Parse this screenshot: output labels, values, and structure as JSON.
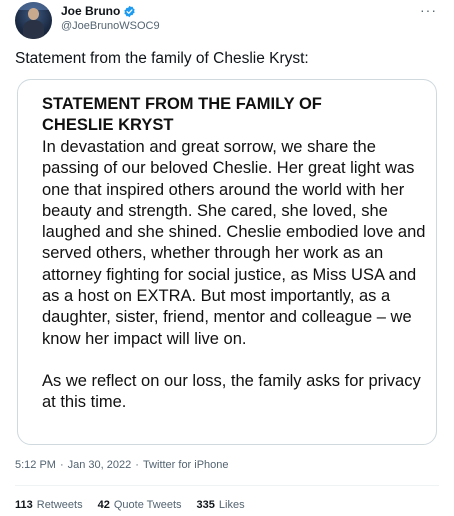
{
  "author": {
    "name": "Joe Bruno",
    "handle": "@JoeBrunoWSOC9",
    "verified_icon": "verified-badge-icon",
    "verified_color": "#1d9bf0"
  },
  "tweet": {
    "text": "Statement from the family of Cheslie Kryst:"
  },
  "statement": {
    "title": "STATEMENT FROM THE FAMILY OF CHESLIE KRYST",
    "paragraph1": "In devastation and great sorrow, we share the passing of our beloved Cheslie. Her great light was one that inspired others around the world with her beauty and strength. She cared, she loved, she laughed and she shined. Cheslie embodied love and served others, whether through her work as an attorney fighting for social justice, as Miss USA and as a host on EXTRA. But most importantly, as a daughter, sister, friend, mentor and colleague – we know her impact will live on.",
    "paragraph2": "As we reflect on our loss, the family asks for privacy at this time."
  },
  "meta": {
    "time": "5:12 PM",
    "separator1": "·",
    "date": "Jan 30, 2022",
    "separator2": "·",
    "source": "Twitter for iPhone"
  },
  "stats": {
    "retweets_count": "113",
    "retweets_label": "Retweets",
    "quotes_count": "42",
    "quotes_label": "Quote Tweets",
    "likes_count": "335",
    "likes_label": "Likes"
  },
  "more_icon": "more-horizontal-icon"
}
